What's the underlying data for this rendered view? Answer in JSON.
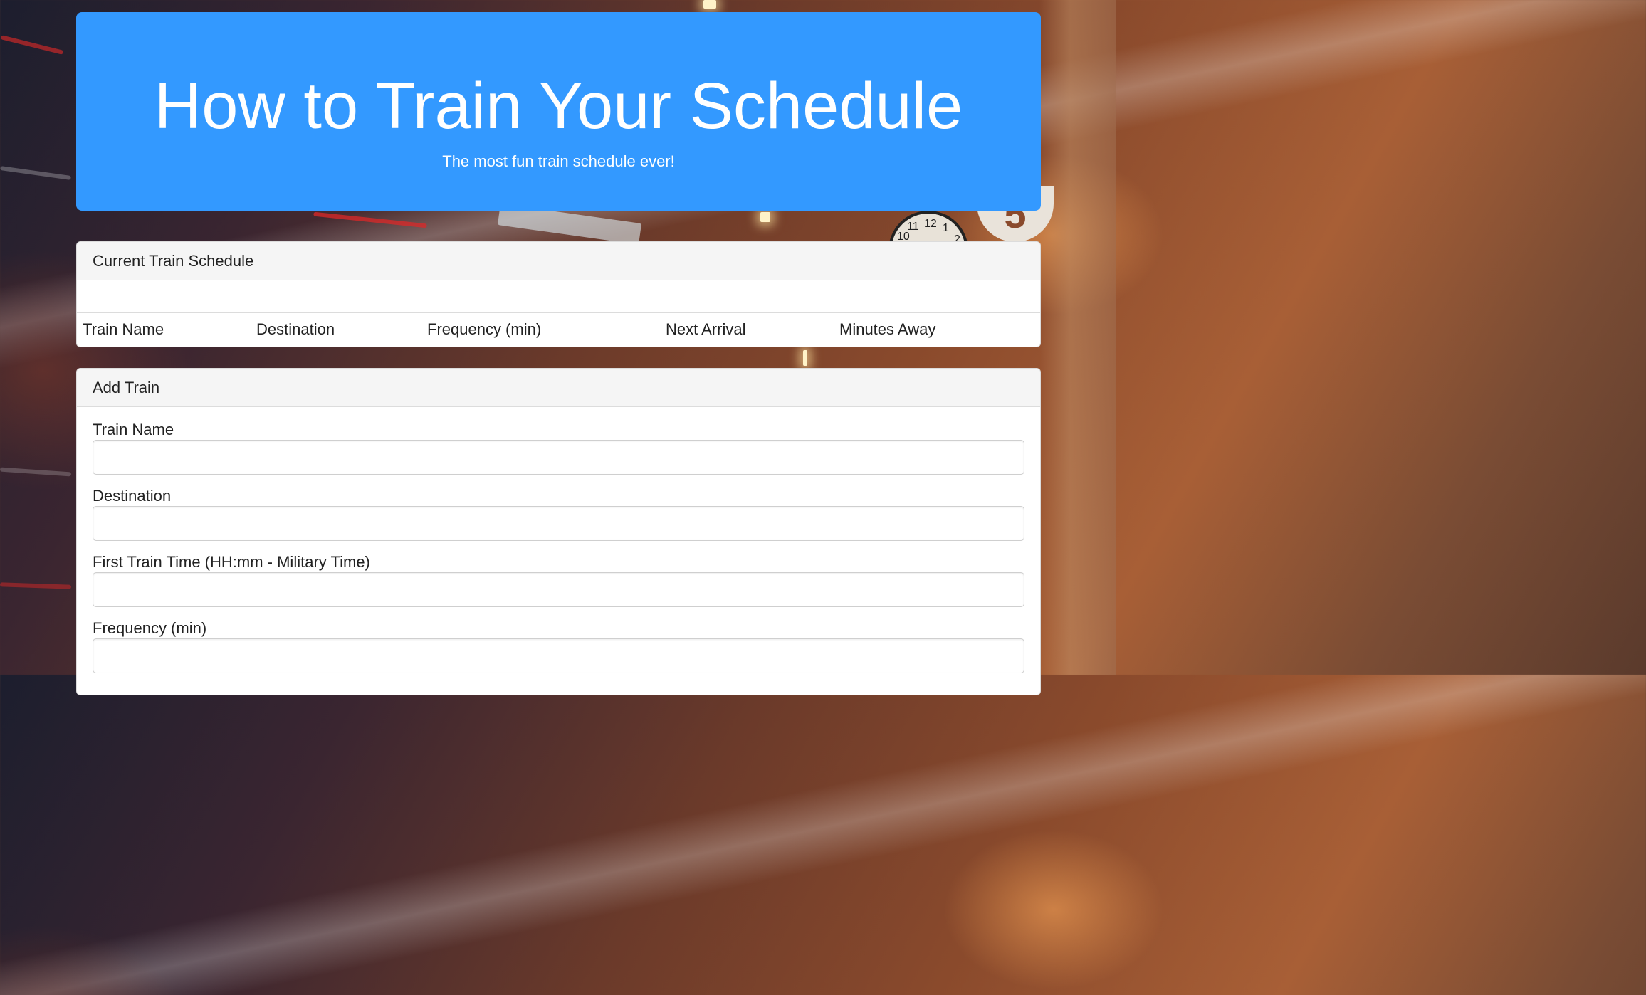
{
  "header": {
    "title": "How to Train Your Schedule",
    "subtitle": "The most fun train schedule ever!"
  },
  "schedule": {
    "heading": "Current Train Schedule",
    "columns": [
      "Train Name",
      "Destination",
      "Frequency (min)",
      "Next Arrival",
      "Minutes Away"
    ]
  },
  "add_train": {
    "heading": "Add Train",
    "fields": [
      {
        "label": "Train Name",
        "value": "",
        "placeholder": ""
      },
      {
        "label": "Destination",
        "value": "",
        "placeholder": ""
      },
      {
        "label": "First Train Time (HH:mm - Military Time)",
        "value": "",
        "placeholder": ""
      },
      {
        "label": "Frequency (min)",
        "value": "",
        "placeholder": ""
      }
    ]
  },
  "background": {
    "sign_number": "5",
    "clock_numbers": [
      "12",
      "1",
      "2",
      "10",
      "11"
    ]
  },
  "colors": {
    "header_bg": "#3399ff",
    "header_text": "#ffffff",
    "panel_heading_bg": "#f5f5f5"
  }
}
